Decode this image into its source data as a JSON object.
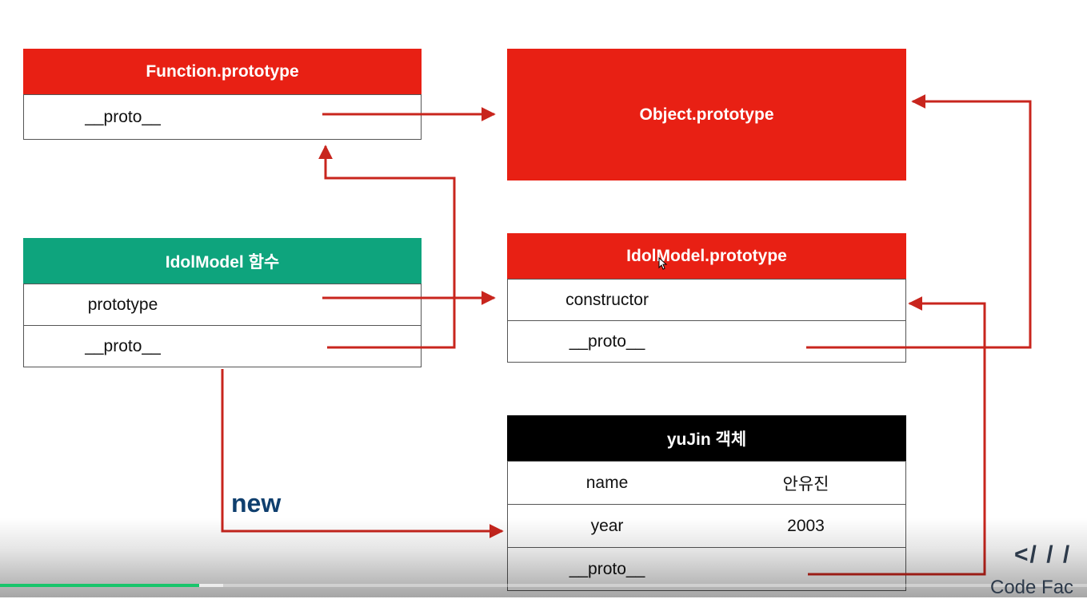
{
  "function_prototype": {
    "title": "Function.prototype",
    "rows": [
      {
        "label": "__proto__",
        "value": ""
      }
    ]
  },
  "object_prototype": {
    "title": "Object.prototype"
  },
  "idol_model_function": {
    "title": "IdolModel 함수",
    "rows": [
      {
        "label": "prototype",
        "value": ""
      },
      {
        "label": "__proto__",
        "value": ""
      }
    ]
  },
  "idol_model_prototype": {
    "title": "IdolModel.prototype",
    "rows": [
      {
        "label": "constructor",
        "value": ""
      },
      {
        "label": "__proto__",
        "value": ""
      }
    ]
  },
  "yujin_object": {
    "title": "yuJin 객체",
    "rows": [
      {
        "label": "name",
        "value": "안유진"
      },
      {
        "label": "year",
        "value": "2003"
      },
      {
        "label": "__proto__",
        "value": ""
      }
    ]
  },
  "new_label": "new",
  "colors": {
    "red": "#e82014",
    "green": "#0ea47d",
    "black": "#000000",
    "arrow": "#c8251d"
  },
  "video": {
    "played_fraction": 0.183,
    "buffered_fraction": 0.205
  },
  "logo": {
    "mark": "</ / /",
    "text": "Code Fac"
  }
}
